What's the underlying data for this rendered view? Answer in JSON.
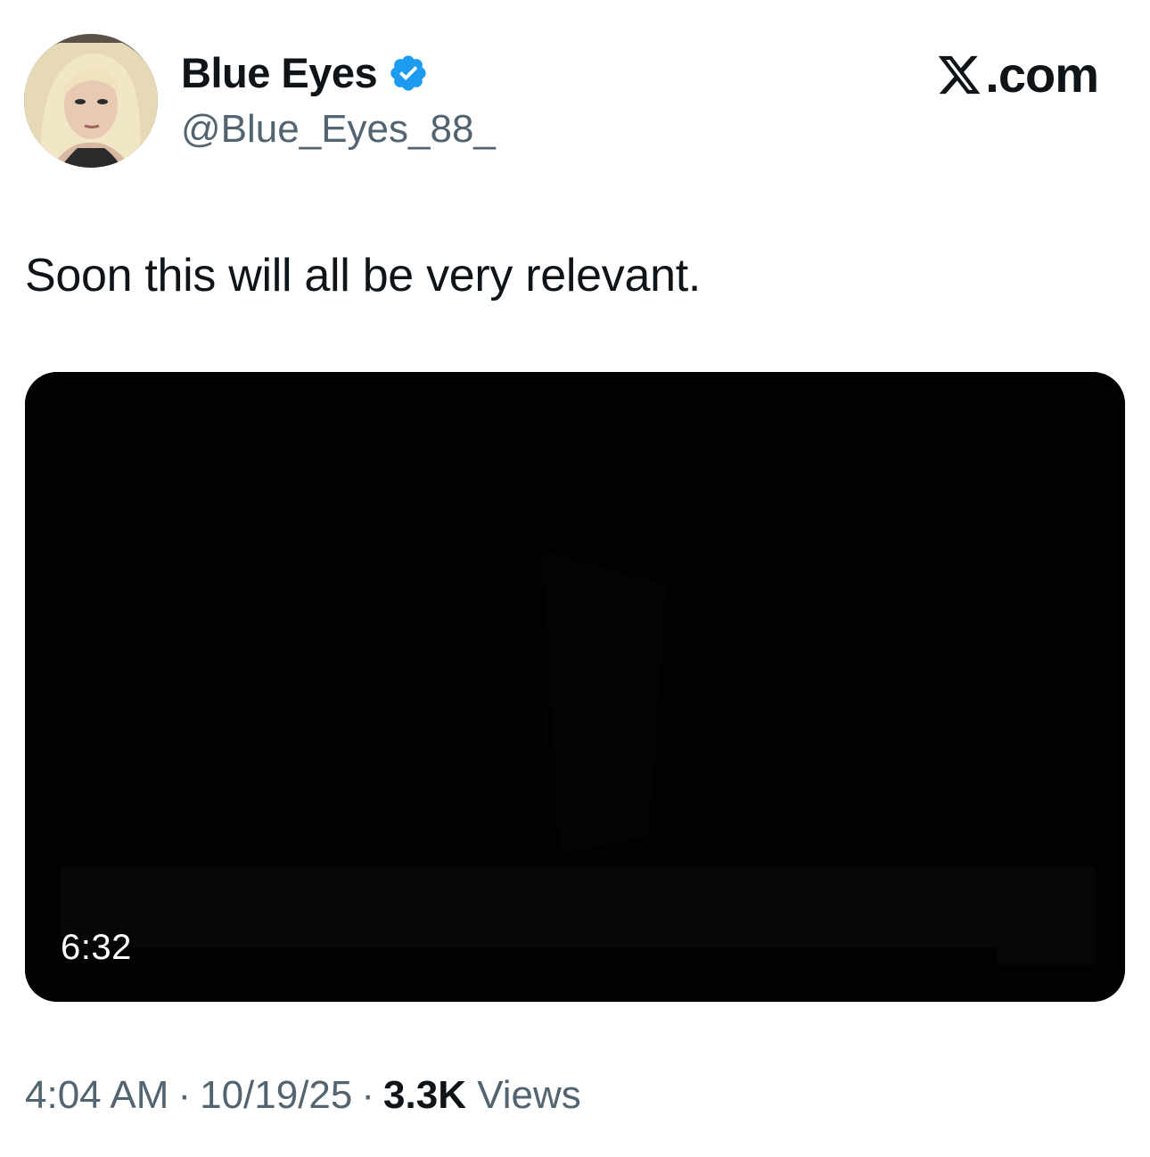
{
  "author": {
    "display_name": "Blue Eyes",
    "handle": "@Blue_Eyes_88_",
    "verified": true,
    "verified_icon": "verified-badge-icon",
    "verified_color": "#1d9bf0"
  },
  "brand": {
    "label": ".com",
    "icon": "x-logo-icon"
  },
  "tweet": {
    "text": "Soon this will all be very relevant."
  },
  "media": {
    "type": "video",
    "duration": "6:32",
    "background_color": "#020202"
  },
  "meta": {
    "time": "4:04 AM",
    "separator_1": "·",
    "date": "10/19/25",
    "separator_2": "·",
    "views_count": "3.3K",
    "views_label": "Views"
  },
  "colors": {
    "text_primary": "#0f1419",
    "text_secondary": "#536471"
  }
}
